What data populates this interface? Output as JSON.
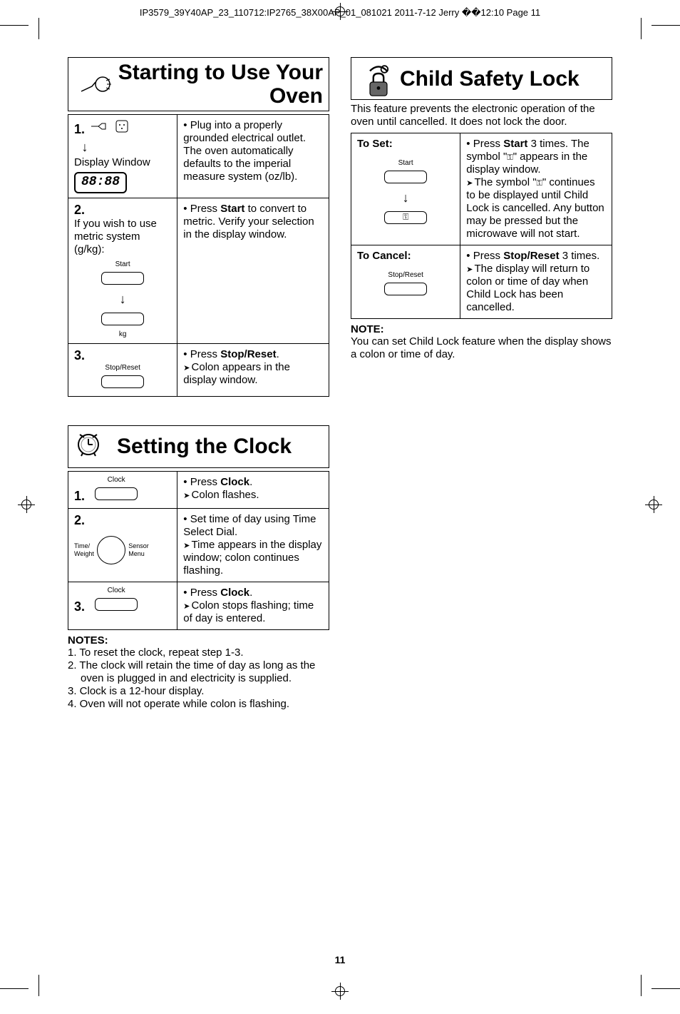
{
  "header": "IP3579_39Y40AP_23_110712:IP2765_38X00AP_01_081021  2011-7-12  Jerry  ��12:10  Page 11",
  "page_number": "11",
  "sections": {
    "starting": {
      "title": "Starting to Use Your Oven",
      "step1": {
        "num": "1.",
        "left_label": "Display Window",
        "display_value": "88:88",
        "right": "• Plug into a properly grounded electrical outlet.\nThe oven automatically defaults to the imperial measure system (oz/lb)."
      },
      "step2": {
        "num": "2.",
        "left_text": "If you wish to use metric system (g/kg):",
        "btn_label": "Start",
        "kg_label": "kg",
        "right": "• Press Start to convert to metric. Verify your selection in the display window."
      },
      "step3": {
        "num": "3.",
        "btn_label": "Stop/Reset",
        "right": "• Press Stop/Reset.",
        "right_sub": "Colon appears in the display window."
      }
    },
    "clock": {
      "title": "Setting the Clock",
      "step1": {
        "num": "1.",
        "btn_label": "Clock",
        "right": "• Press Clock.",
        "right_sub": "Colon flashes."
      },
      "step2": {
        "num": "2.",
        "dial_left": "Time/\nWeight",
        "dial_right": "Sensor\nMenu",
        "right": "• Set time of day using Time Select Dial.",
        "right_sub": "Time appears in the display window; colon continues flashing."
      },
      "step3": {
        "num": "3.",
        "btn_label": "Clock",
        "right": "• Press Clock.",
        "right_sub": "Colon stops flashing; time of day is entered."
      },
      "notes_title": "NOTES:",
      "notes": [
        "1. To reset the clock, repeat step 1-3.",
        "2. The clock will retain the time of day as long as the oven is plugged in and electricity is supplied.",
        "3. Clock is a 12-hour display.",
        "4. Oven will not operate while colon is flashing."
      ]
    },
    "childlock": {
      "title": "Child Safety Lock",
      "intro": "This feature prevents the electronic operation of the oven until cancelled. It does not lock the door.",
      "set": {
        "label": "To Set:",
        "btn_label": "Start",
        "right_l1": "• Press Start 3 times. The symbol \"",
        "right_l1b": "\" appears in the display window.",
        "right_sub_a": "The symbol \"",
        "right_sub_b": "\" continues to be displayed until Child Lock is cancelled. Any button may be pressed but the microwave will not start."
      },
      "cancel": {
        "label": "To Cancel:",
        "btn_label": "Stop/Reset",
        "right": "• Press Stop/Reset 3 times.",
        "right_sub": "The display will return to colon or time of day when Child Lock has been cancelled."
      },
      "note_title": "NOTE:",
      "note": "You can set Child Lock feature when the display shows a colon or time of day."
    }
  }
}
